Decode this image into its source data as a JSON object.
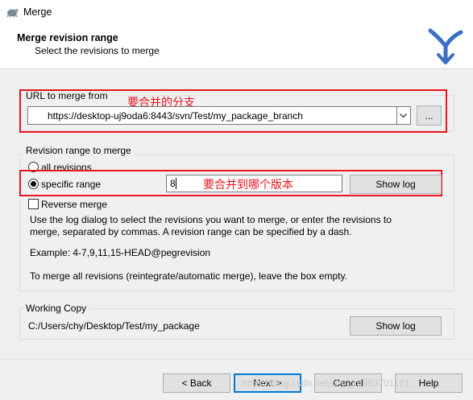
{
  "window": {
    "title": "Merge"
  },
  "header": {
    "title": "Merge revision range",
    "subtitle": "Select the revisions to merge"
  },
  "url_group": {
    "label": "URL to merge from",
    "url_value": "https://desktop-uj9oda6:8443/svn/Test/my_package_branch",
    "browse_label": "...",
    "annotation": "要合并的分支"
  },
  "revision_group": {
    "label": "Revision range to merge",
    "all_revisions_label": "all revisions",
    "specific_range_label": "specific range",
    "range_value": "8",
    "annotation": "要合并到哪个版本",
    "show_log_label": "Show log",
    "reverse_merge_label": "Reverse merge",
    "help_line1": "Use the log dialog to select the revisions you want to merge, or enter the revisions to",
    "help_line2": "merge, separated by commas. A revision range can be specified by a dash.",
    "example": "Example: 4-7,9,11,15-HEAD@pegrevision",
    "reintegrate_note": "To merge all revisions (reintegrate/automatic merge), leave the box empty."
  },
  "working_copy_group": {
    "label": "Working Copy",
    "path": "C:/Users/chy/Desktop/Test/my_package",
    "show_log_label": "Show log"
  },
  "footer": {
    "back_label": "< Back",
    "next_label": "Next >",
    "cancel_label": "Cancel",
    "help_label": "Help",
    "watermark": "https://blog.csdn.net/chy_18883701161"
  },
  "colors": {
    "annotation": "#e8141e",
    "accent": "#0078d7"
  }
}
